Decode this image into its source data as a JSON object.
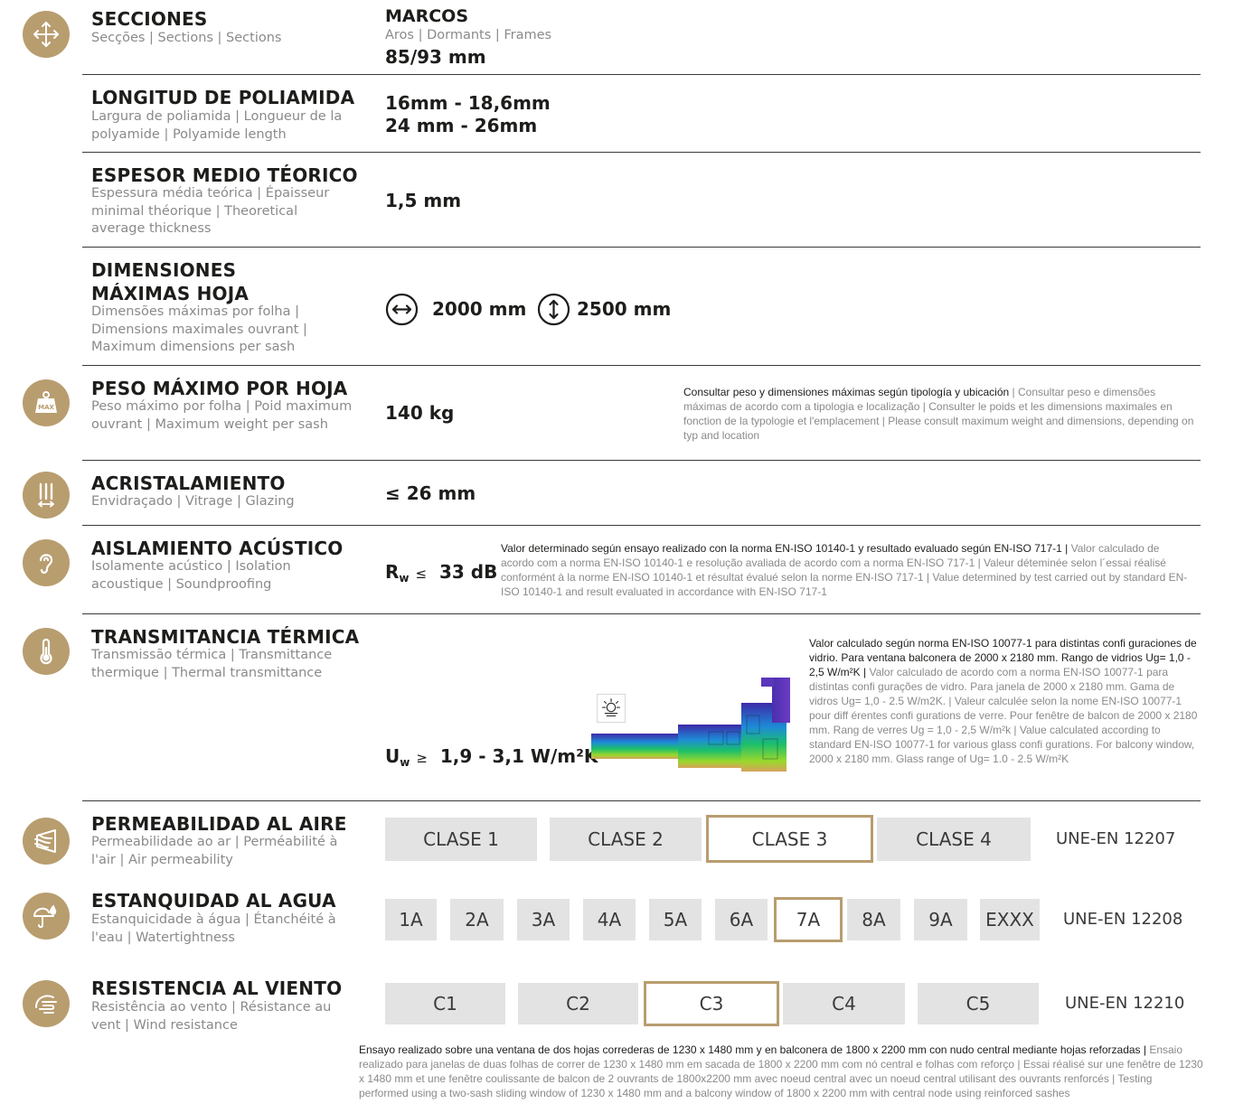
{
  "sections": {
    "title": "SECCIONES",
    "sub": "Secções | Sections | Sections",
    "value_title": "MARCOS",
    "value_sub": "Aros | Dormants | Frames",
    "value": "85/93 mm"
  },
  "polyamide": {
    "title": "LONGITUD DE POLIAMIDA",
    "sub": "Largura de poliamida | Longueur de la polyamide | Polyamide length",
    "value_1": "16mm - 18,6mm",
    "value_2": "24 mm - 26mm"
  },
  "thickness": {
    "title": "ESPESOR MEDIO TÉORICO",
    "sub": "Espessura média teórica | Épaisseur minimal théorique | Theoretical average thickness",
    "value": "1,5 mm"
  },
  "dimensions": {
    "title_1": "DIMENSIONES",
    "title_2": "MÁXIMAS HOJA",
    "sub": "Dimensões máximas por folha | Dimensions maximales ouvrant | Maximum dimensions per sash",
    "width": "2000 mm",
    "height": "2500 mm"
  },
  "weight": {
    "title": "PESO MÁXIMO POR HOJA",
    "sub": "Peso máximo por folha | Poid maximum ouvrant | Maximum weight per sash",
    "value": "140 kg",
    "icon_text": "MAX",
    "note_dark": "Consultar peso y dimensiones máximas según tipología y ubicación",
    "note_light": " | Consultar peso e dimensões máximas de acordo com a tipologia e localização | Consulter le poids et les dimensions maximales en fonction de la typologie et l'emplacement | Please consult maximum weight and dimensions, depending on typ and location"
  },
  "glazing": {
    "title": "ACRISTALAMIENTO",
    "sub": "Envidraçado | Vitrage | Glazing",
    "value": "≤ 26 mm"
  },
  "acoustic": {
    "title": "AISLAMIENTO ACÚSTICO",
    "sub": "Isolamente acústico | Isolation acoustique | Soundproofing",
    "symbol": "R",
    "subscript": "w",
    "op": "≤",
    "value": "33 dB",
    "note_dark": "Valor determinado según ensayo realizado con la norma EN-ISO 10140-1 y resultado evaluado según EN-ISO 717-1 |",
    "note_light": " Valor calculado de acordo com a norma EN-ISO 10140-1 e resolução avaliada de acordo com a norma EN-ISO 717-1 | Valeur déteminée selon l´essai réalisé conformént à la norme EN-ISO 10140-1 et résultat évalué selon la norme EN-ISO 717-1 | Value determined by test carried out by standard EN-ISO 10140-1 and result evaluated in accordance with EN-ISO 717-1"
  },
  "thermal": {
    "title": "TRANSMITANCIA TÉRMICA",
    "sub": "Transmissão térmica | Transmittance thermique | Thermal transmittance",
    "symbol": "U",
    "subscript": "w",
    "op": "≥",
    "value": "1,9 - 3,1  W/m²K",
    "note_dark": "Valor calculado según norma EN-ISO 10077-1 para distintas confi guraciones de vidrio. Para ventana balconera de 2000 x 2180 mm. Rango de vidrios Ug= 1,0 - 2,5 W/m²K |",
    "note_light": " Valor calculado de acordo com a norma EN-ISO 10077-1 para distintas confi gurações de vidro. Para janela de 2000 x 2180 mm. Gama de vidros Ug= 1,0 - 2.5 W/m2K. | Valeur calculée selon la nome EN-ISO 10077-1 pour diff érentes confi gurations de verre. Pour fenêtre de balcon de 2000 x 2180 mm. Rang de verres Ug = 1,0 - 2,5 W/m²k | Value calculated according to standard EN-ISO 10077-1 for various glass confi gurations. For balcony window, 2000 x 2180 mm. Glass range of Ug= 1.0 - 2.5 W/m²K"
  },
  "air": {
    "title": "PERMEABILIDAD AL AIRE",
    "sub": "Permeabilidade ao ar | Perméabilité à l'air | Air permeability",
    "classes": [
      "CLASE 1",
      "CLASE 2",
      "CLASE 3",
      "CLASE 4"
    ],
    "selected": "CLASE 3",
    "standard": "UNE-EN 12207"
  },
  "water": {
    "title": "ESTANQUIDAD AL AGUA",
    "sub": "Estanquicidade à água | Étanchéité à l'eau | Watertightness",
    "classes": [
      "1A",
      "2A",
      "3A",
      "4A",
      "5A",
      "6A",
      "7A",
      "8A",
      "9A",
      "EXXX"
    ],
    "selected": "7A",
    "standard": "UNE-EN 12208"
  },
  "wind": {
    "title": "RESISTENCIA AL VIENTO",
    "sub": "Resistência ao vento | Résistance au vent | Wind resistance",
    "classes": [
      "C1",
      "C2",
      "C3",
      "C4",
      "C5"
    ],
    "selected": "C3",
    "standard": "UNE-EN 12210"
  },
  "footer": {
    "note_dark": "Ensayo realizado sobre una ventana de dos hojas correderas de 1230 x 1480 mm y en balconera de 1800 x 2200 mm con nudo central mediante hojas reforzadas |",
    "note_light": " Ensaio realizado para janelas de duas folhas de correr de 1230 x 1480 mm em sacada de 1800 x 2200 mm com nó central e folhas com reforço | Essai réalisé sur une fenêtre de 1230 x 1480 mm et une fenêtre coulissante de balcon de 2 ouvrants de 1800x2200 mm avec noeud central avec un noeud central utilisant des ouvrants renforcés | Testing performed using a two-sash sliding window of 1230 x 1480 mm and a balcony window of 1800 x 2200 mm with central node using reinforced sashes"
  },
  "colors": {
    "accent": "#b89d6f",
    "box": "#e3e3e3",
    "muted": "#8a8a8a",
    "text": "#1d1d1b"
  },
  "icons": [
    "move-arrows-icon",
    "weight-max-icon",
    "glazing-icon",
    "ear-icon",
    "thermometer-icon",
    "air-flow-icon",
    "water-umbrella-icon",
    "wind-hand-icon"
  ]
}
